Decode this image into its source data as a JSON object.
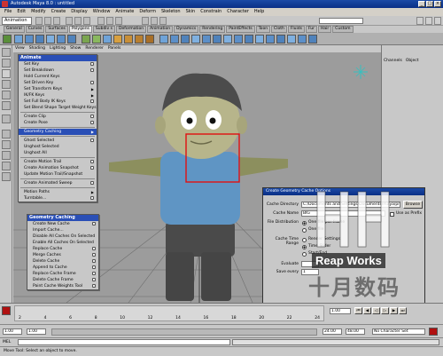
{
  "window": {
    "title": "Autodesk Maya 8.0 : untitled"
  },
  "menubar": [
    "File",
    "Edit",
    "Modify",
    "Create",
    "Display",
    "Window",
    "Animate",
    "Deform",
    "Skeleton",
    "Skin",
    "Constrain",
    "Character",
    "Help"
  ],
  "statusline": {
    "mode": "Animation"
  },
  "shelf_tabs": [
    "General",
    "Curves",
    "Surfaces",
    "Polygons",
    "Subdiv s",
    "Deformation",
    "Animation",
    "Dynamics",
    "Rendering",
    "PaintEffects",
    "Toon",
    "Cloth",
    "Fluids",
    "Fur",
    "Hair",
    "Custom"
  ],
  "shelf_active_tab": "Polygons",
  "viewport_menu": [
    "View",
    "Shading",
    "Lighting",
    "Show",
    "Renderer",
    "Panels"
  ],
  "right_panel": {
    "tabs": [
      "Channels",
      "Object"
    ]
  },
  "animate_menu": {
    "title": "Animate",
    "items": [
      {
        "label": "Set Key",
        "opt": true
      },
      {
        "label": "Set Breakdown",
        "opt": true
      },
      {
        "label": "Hold Current Keys",
        "opt": false
      },
      {
        "label": "Set Driven Key",
        "opt": true
      },
      {
        "label": "Set Transform Keys",
        "opt": false,
        "arrow": true
      },
      {
        "label": "IK/FK Keys",
        "opt": false,
        "arrow": true
      },
      {
        "label": "Set Full Body IK Keys",
        "opt": true
      },
      {
        "label": "Set Blend Shape Target Weight Keys",
        "opt": false
      },
      {
        "label": "Create Clip",
        "opt": true
      },
      {
        "label": "Create Pose",
        "opt": true
      },
      {
        "label": "Geometry Caching",
        "opt": false,
        "arrow": true,
        "highlight": true
      },
      {
        "label": "Ghost Selected",
        "opt": true
      },
      {
        "label": "Unghost Selected",
        "opt": false
      },
      {
        "label": "Unghost All",
        "opt": false
      },
      {
        "label": "Create Motion Trail",
        "opt": true
      },
      {
        "label": "Create Animation Snapshot",
        "opt": true
      },
      {
        "label": "Update Motion Trail/Snapshot",
        "opt": false
      },
      {
        "label": "Create Animated Sweep",
        "opt": true
      },
      {
        "label": "Motion Paths",
        "opt": false,
        "arrow": true
      },
      {
        "label": "Turntable...",
        "opt": true
      }
    ]
  },
  "geometry_caching_menu": {
    "title": "Geometry Caching",
    "items": [
      {
        "label": "Create New Cache",
        "opt": true
      },
      {
        "label": "Import Cache...",
        "opt": false
      },
      {
        "label": "Disable All Caches On Selected",
        "opt": false
      },
      {
        "label": "Enable All Caches On Selected",
        "opt": false
      },
      {
        "label": "Replace Cache",
        "opt": true
      },
      {
        "label": "Merge Caches",
        "opt": true
      },
      {
        "label": "Delete Cache",
        "opt": true
      },
      {
        "label": "Append to Cache",
        "opt": true
      },
      {
        "label": "Replace Cache Frame",
        "opt": true
      },
      {
        "label": "Delete Cache Frame",
        "opt": true
      },
      {
        "label": "Paint Cache Weights Tool",
        "opt": true
      }
    ]
  },
  "cache_dialog": {
    "title": "Create Geometry Cache Options",
    "cache_directory_label": "Cache Directory",
    "cache_directory_value": "C:/Documents and Settings/Documents/maya/projects/default/data/",
    "browse_label": "Browse",
    "cache_name_label": "Cache Name",
    "cache_name_value": "BIG",
    "use_prefix_label": "Use as Prefix",
    "file_distribution_label": "File Distribution",
    "file_distribution_options": [
      "One file per frame",
      "One file"
    ],
    "time_range_label": "Cache Time Range",
    "time_range_options": [
      "Render Settings",
      "Time Slider",
      "Start/End"
    ],
    "evaluate_label": "Evaluate",
    "save_every_label": "Save every",
    "save_every_value": "1",
    "buttons": {
      "create": "Create",
      "apply": "Apply",
      "close": "Close"
    }
  },
  "timeslider": {
    "ticks": [
      "2",
      "4",
      "6",
      "8",
      "10",
      "12",
      "14",
      "16",
      "18",
      "20",
      "22",
      "24"
    ],
    "current_frame": "1.00"
  },
  "rangebar": {
    "start": "1.00",
    "inner_start": "1.00",
    "inner_end": "24.00",
    "end": "48.00",
    "character_set": "No Character Set"
  },
  "cmdline": {
    "label": "MEL"
  },
  "helpline": {
    "text": "Move Tool: Select an object to move."
  },
  "watermark": {
    "brand": "Reap Works",
    "cn": "十月数码"
  }
}
